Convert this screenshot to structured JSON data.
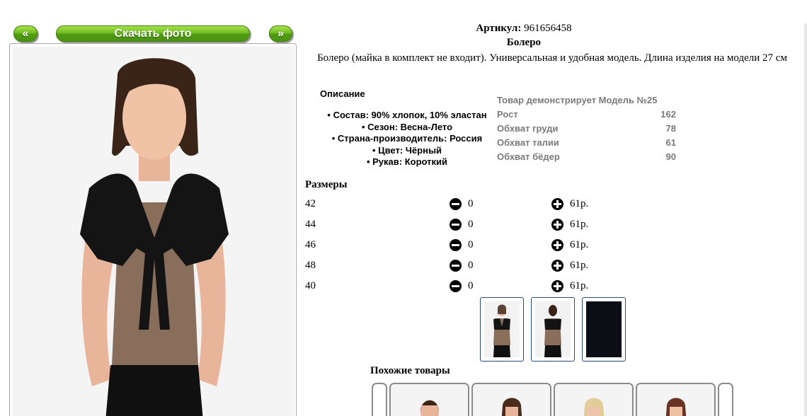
{
  "nav": {
    "prev_label": "«",
    "download_label": "Скачать фото",
    "next_label": "»"
  },
  "product": {
    "article_label": "Артикул:",
    "article_value": "961656458",
    "name": "Болеро",
    "description": "Болеро (майка в комплект не входит). Универсальная и удобная модель. Длина изделия на модели 27 см"
  },
  "details": {
    "heading": "Описание",
    "attributes": [
      "Состав: 90% хлопок, 10% эластан",
      "Сезон: Весна-Лето",
      "Страна-производитель: Россия",
      "Цвет: Чёрный",
      "Рукав: Короткий"
    ]
  },
  "model": {
    "title": "Товар демонстрирует Модель №25",
    "rows": [
      {
        "label": "Рост",
        "value": "162"
      },
      {
        "label": "Обхват груди",
        "value": "78"
      },
      {
        "label": "Обхват талии",
        "value": "61"
      },
      {
        "label": "Обхват бёдер",
        "value": "90"
      }
    ]
  },
  "sizes": {
    "heading": "Размеры",
    "rows": [
      {
        "size": "42",
        "qty": "0",
        "price": "61р."
      },
      {
        "size": "44",
        "qty": "0",
        "price": "61р."
      },
      {
        "size": "46",
        "qty": "0",
        "price": "61р."
      },
      {
        "size": "48",
        "qty": "0",
        "price": "61р."
      },
      {
        "size": "40",
        "qty": "0",
        "price": "61р."
      }
    ]
  },
  "similar": {
    "heading": "Похожие товары"
  },
  "icons": {
    "minus": "minus-circle-icon",
    "plus": "plus-circle-icon"
  },
  "colors": {
    "button_green": "#72bd24",
    "thumb_border": "#274a78",
    "model_text": "#7a7a7a"
  }
}
